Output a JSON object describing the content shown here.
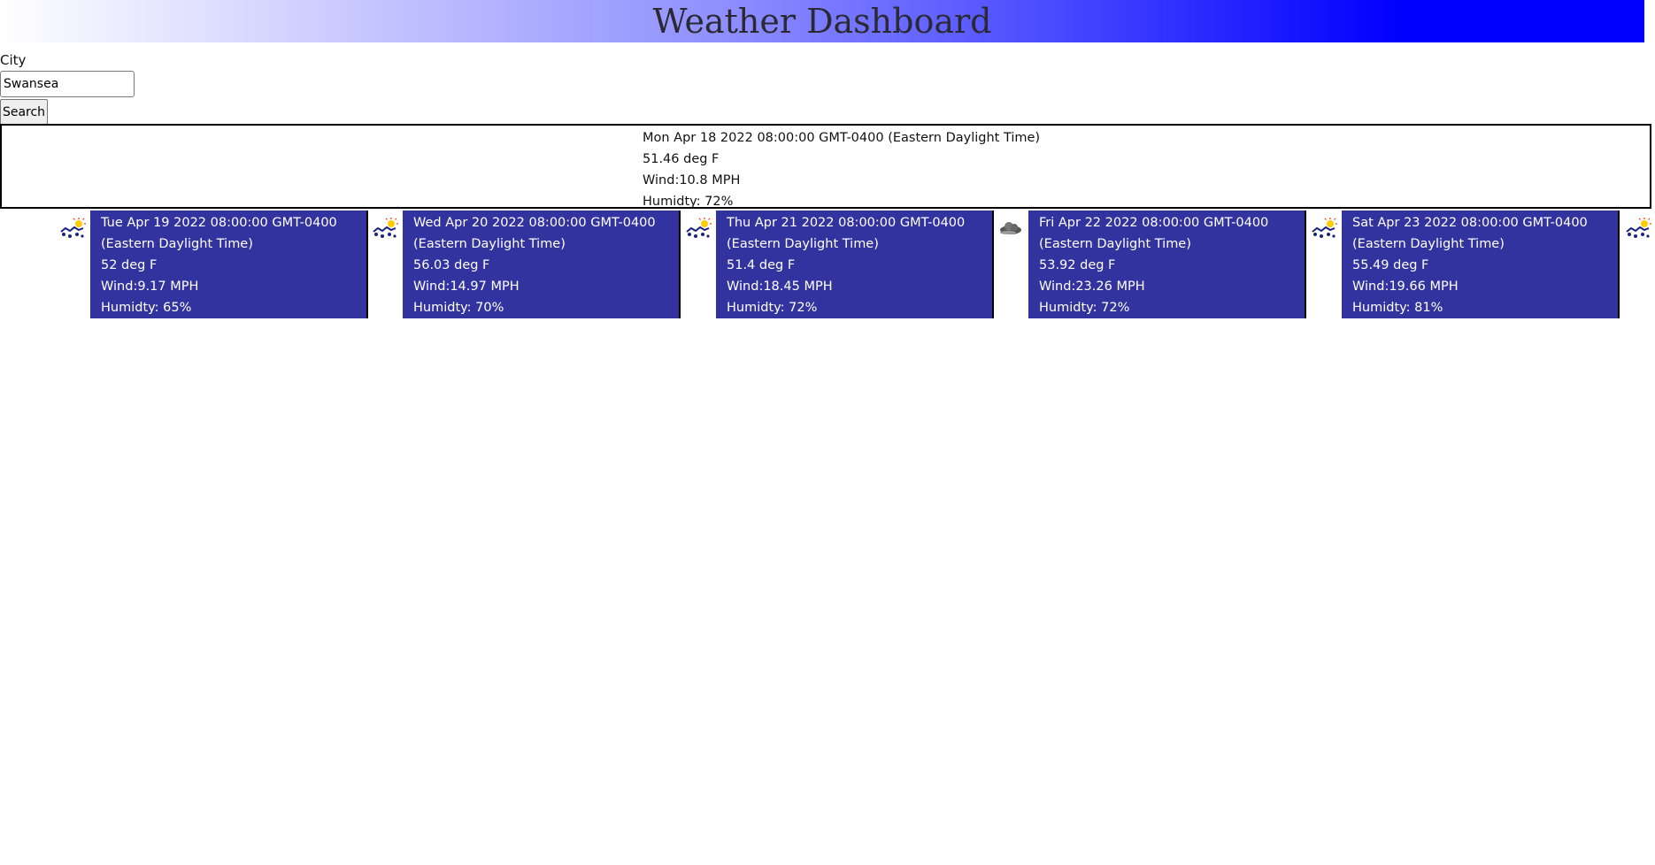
{
  "header": {
    "title": "Weather Dashboard"
  },
  "search": {
    "label": "City",
    "value": "Swansea",
    "button_label": "Search"
  },
  "current": {
    "date": "Mon Apr 18 2022 08:00:00 GMT-0400 (Eastern Daylight Time)",
    "temp": "51.46 deg F",
    "wind": "Wind:10.8 MPH",
    "humidity": "Humidty: 72%"
  },
  "forecast": [
    {
      "date_line1": "Tue Apr 19 2022 08:00:00 GMT-0400",
      "date_line2": "(Eastern Daylight Time)",
      "temp": "52 deg F",
      "wind": "Wind:9.17 MPH",
      "humidity": "Humidty: 65%",
      "icon": "rain-sun-icon"
    },
    {
      "date_line1": "Wed Apr 20 2022 08:00:00 GMT-0400",
      "date_line2": "(Eastern Daylight Time)",
      "temp": "56.03 deg F",
      "wind": "Wind:14.97 MPH",
      "humidity": "Humidty: 70%",
      "icon": "rain-sun-icon"
    },
    {
      "date_line1": "Thu Apr 21 2022 08:00:00 GMT-0400",
      "date_line2": "(Eastern Daylight Time)",
      "temp": "51.4 deg F",
      "wind": "Wind:18.45 MPH",
      "humidity": "Humidty: 72%",
      "icon": "rain-sun-icon"
    },
    {
      "date_line1": "Fri Apr 22 2022 08:00:00 GMT-0400",
      "date_line2": "(Eastern Daylight Time)",
      "temp": "53.92 deg F",
      "wind": "Wind:23.26 MPH",
      "humidity": "Humidty: 72%",
      "icon": "cloud-icon"
    },
    {
      "date_line1": "Sat Apr 23 2022 08:00:00 GMT-0400",
      "date_line2": "(Eastern Daylight Time)",
      "temp": "55.49 deg F",
      "wind": "Wind:19.66 MPH",
      "humidity": "Humidty: 81%",
      "icon": "rain-sun-icon"
    }
  ],
  "trailing_icon": "rain-sun-icon",
  "colors": {
    "card_background": "#3333a0",
    "banner_end": "#0000ff"
  }
}
